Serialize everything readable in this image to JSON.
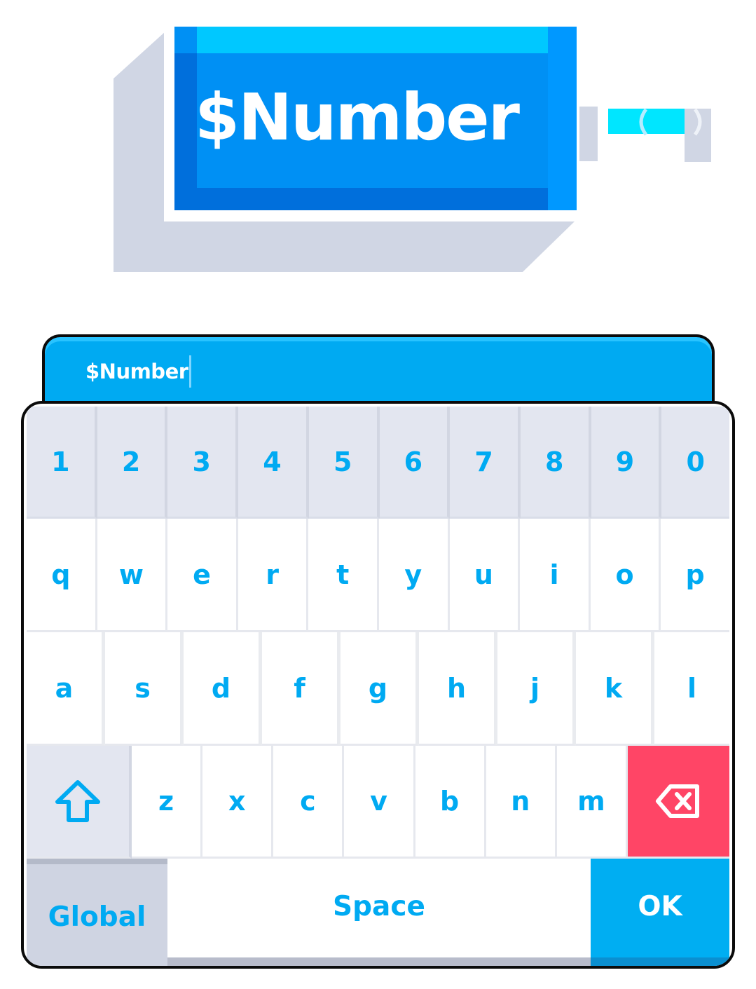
{
  "banner": {
    "title": "$Number"
  },
  "input": {
    "value": "$Number"
  },
  "keyboard": {
    "number_row": [
      "1",
      "2",
      "3",
      "4",
      "5",
      "6",
      "7",
      "8",
      "9",
      "0"
    ],
    "row1": [
      "q",
      "w",
      "e",
      "r",
      "t",
      "y",
      "u",
      "i",
      "o",
      "p"
    ],
    "row2": [
      "a",
      "s",
      "d",
      "f",
      "g",
      "h",
      "j",
      "k",
      "l"
    ],
    "row3": [
      "z",
      "x",
      "c",
      "v",
      "b",
      "n",
      "m"
    ],
    "global_label": "Global",
    "space_label": "Space",
    "ok_label": "OK",
    "shift_icon": "shift-arrow-icon",
    "backspace_icon": "backspace-icon"
  },
  "colors": {
    "accent": "#00aaf2",
    "banner_blue": "#0090f4",
    "backspace_red": "#ff4566",
    "number_row_bg": "#e3e6f0"
  }
}
